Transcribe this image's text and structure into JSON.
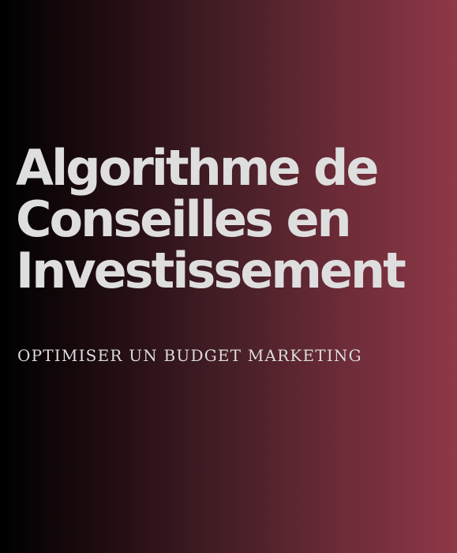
{
  "title": {
    "lines": [
      "Algorithme de",
      "Conseilles en",
      "Investissement"
    ]
  },
  "subtitle": "OPTIMISER UN BUDGET MARKETING",
  "colors": {
    "background_start": "#000000",
    "background_end": "#8f3848",
    "text": "#dedede"
  }
}
